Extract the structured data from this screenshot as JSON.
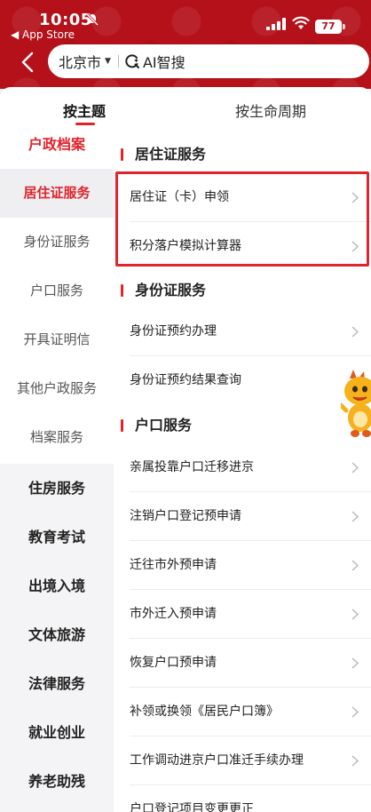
{
  "status_bar": {
    "time": "10:05",
    "back_app_label": "◀ App Store",
    "battery": "77"
  },
  "search": {
    "city": "北京市",
    "ai_label": "AI智搜"
  },
  "tabs": [
    {
      "label": "按主题",
      "active": true
    },
    {
      "label": "按生命周期",
      "active": false
    }
  ],
  "sidebar": {
    "category": "户政档案",
    "sub_items": [
      {
        "label": "居住证服务",
        "active": true
      },
      {
        "label": "身份证服务"
      },
      {
        "label": "户口服务"
      },
      {
        "label": "开具证明信"
      },
      {
        "label": "其他户政服务"
      },
      {
        "label": "档案服务"
      }
    ],
    "main_items": [
      {
        "label": "住房服务"
      },
      {
        "label": "教育考试"
      },
      {
        "label": "出境入境"
      },
      {
        "label": "文体旅游"
      },
      {
        "label": "法律服务"
      },
      {
        "label": "就业创业"
      },
      {
        "label": "养老助残"
      }
    ]
  },
  "sections": [
    {
      "title": "居住证服务",
      "highlighted": true,
      "items": [
        "居住证（卡）申领",
        "积分落户模拟计算器"
      ]
    },
    {
      "title": "身份证服务",
      "items": [
        "身份证预约办理",
        "身份证预约结果查询"
      ]
    },
    {
      "title": "户口服务",
      "items": [
        "亲属投靠户口迁移进京",
        "注销户口登记预申请",
        "迁往市外预申请",
        "市外迁入预申请",
        "恢复户口预申请",
        "补领或换领《居民户口簿》",
        "工作调动进京户口准迁手续办理",
        "户口登记项目变更更正"
      ]
    }
  ],
  "colors": {
    "brand_red": "#b4111a",
    "accent_red": "#e0242b",
    "highlight_border": "#e0242b"
  }
}
